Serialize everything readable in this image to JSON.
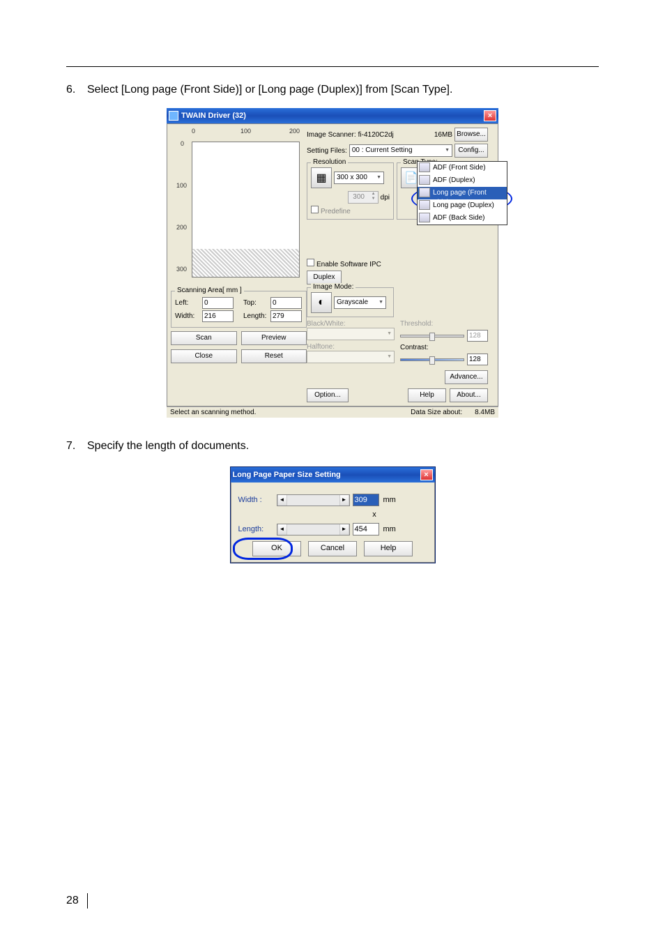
{
  "steps": {
    "step6_num": "6.",
    "step6_text": "Select [Long page (Front Side)] or [Long page (Duplex)] from [Scan Type].",
    "step7_num": "7.",
    "step7_text": "Specify the length of documents."
  },
  "twain": {
    "title": "TWAIN Driver (32)",
    "ruler": {
      "r0": "0",
      "r100": "100",
      "r200": "200",
      "l0": "0",
      "l100": "100",
      "l200": "200",
      "l300": "300"
    },
    "scanarea": {
      "legend": "Scanning Area[ mm ]",
      "left_lbl": "Left:",
      "left_val": "0",
      "top_lbl": "Top:",
      "top_val": "0",
      "width_lbl": "Width:",
      "width_val": "216",
      "length_lbl": "Length:",
      "length_val": "279"
    },
    "buttons": {
      "scan": "Scan",
      "preview": "Preview",
      "close": "Close",
      "reset": "Reset",
      "option": "Option...",
      "help": "Help",
      "about": "About...",
      "advance": "Advance...",
      "browse": "Browse...",
      "config": "Config..."
    },
    "right": {
      "scanner_lbl": "Image Scanner:",
      "scanner_val": "fi-4120C2dj",
      "mem": "16MB",
      "setting_lbl": "Setting Files:",
      "setting_val": "00 : Current Setting",
      "resolution_lbl": "Resolution",
      "res_preset": "300 x 300",
      "res_dpi": "300",
      "dpi_lbl": "dpi",
      "predefine": "Predefine",
      "enable_ipc": "Enable Software IPC",
      "duplex": "Duplex",
      "scantype_lbl": "Scan Type:",
      "scantype_val": "ADF (Duplex)",
      "dd_items": [
        "ADF (Front Side)",
        "ADF (Duplex)",
        "Long page (Front Side)",
        "Long page (Duplex)",
        "ADF (Back Side)"
      ],
      "imagemode_lbl": "Image Mode:",
      "imagemode_val": "Grayscale",
      "bw_lbl": "Black/White:",
      "halftone_lbl": "Halftone:",
      "threshold_lbl": "Threshold:",
      "contrast_lbl": "Contrast:",
      "thr_val": "128",
      "con_val": "128"
    },
    "status": {
      "msg": "Select an scanning method.",
      "datasize_lbl": "Data Size about:",
      "datasize_val": "8.4MB"
    }
  },
  "longpage": {
    "title": "Long Page Paper Size Setting",
    "width_lbl": "Width :",
    "width_val": "309",
    "x": "x",
    "length_lbl": "Length:",
    "length_val": "454",
    "mm": "mm",
    "ok": "OK",
    "cancel": "Cancel",
    "help": "Help"
  },
  "page": "28"
}
